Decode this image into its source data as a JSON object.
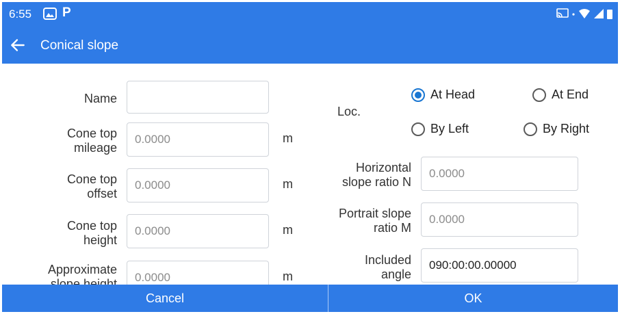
{
  "status_bar": {
    "time": "6:55",
    "app_icon": "P"
  },
  "app_bar": {
    "title": "Conical slope"
  },
  "form": {
    "name": {
      "label": "Name",
      "value": ""
    },
    "cone_top_mileage": {
      "label_1": "Cone top",
      "label_2": "mileage",
      "placeholder": "0.0000",
      "unit": "m"
    },
    "cone_top_offset": {
      "label_1": "Cone top",
      "label_2": "offset",
      "placeholder": "0.0000",
      "unit": "m"
    },
    "cone_top_height": {
      "label_1": "Cone top",
      "label_2": "height",
      "placeholder": "0.0000",
      "unit": "m"
    },
    "approximate_slope_height": {
      "label_1": "Approximate",
      "label_2": "slope height",
      "placeholder": "0.0000",
      "unit": "m"
    },
    "loc": {
      "label": "Loc.",
      "options": [
        "At Head",
        "At End",
        "By Left",
        "By Right"
      ],
      "selected": "At Head"
    },
    "horizontal_slope_ratio": {
      "label_1": "Horizontal",
      "label_2": "slope ratio N",
      "placeholder": "0.0000"
    },
    "portrait_slope_ratio": {
      "label_1": "Portrait slope",
      "label_2": "ratio M",
      "placeholder": "0.0000"
    },
    "included_angle": {
      "label_1": "Included",
      "label_2": "angle",
      "value": "090:00:00.00000"
    }
  },
  "actions": {
    "cancel": "Cancel",
    "ok": "OK"
  },
  "colors": {
    "primary": "#2f7be6",
    "radio_selected": "#1976d2"
  }
}
